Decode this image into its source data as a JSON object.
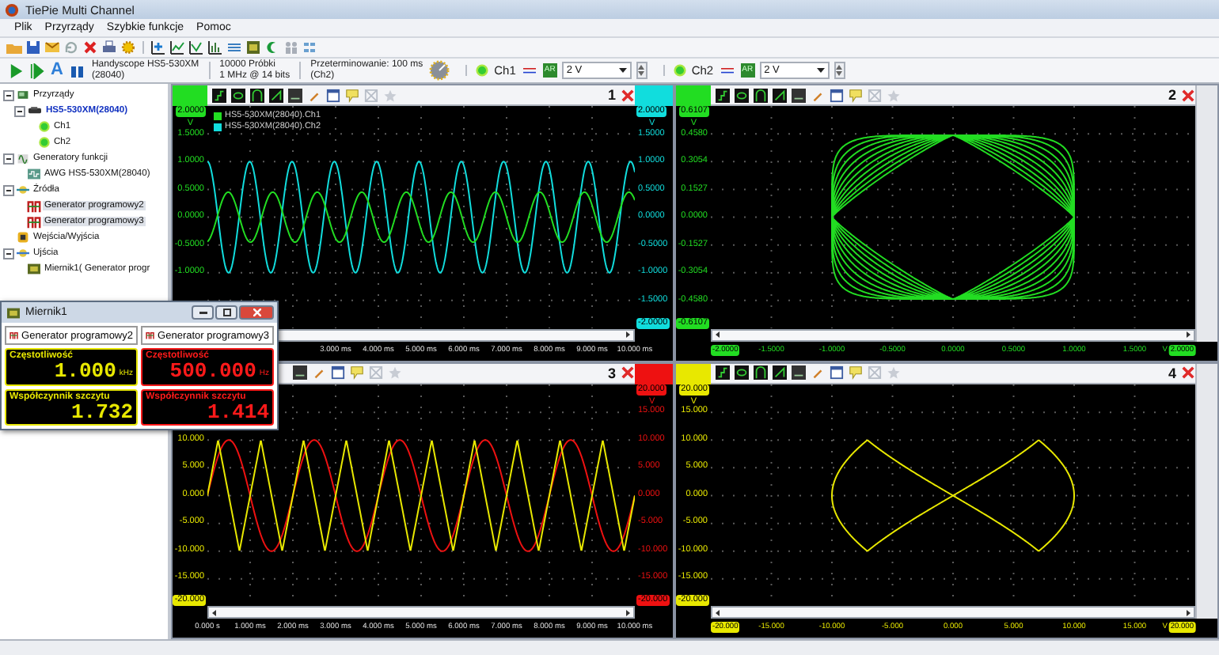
{
  "window": {
    "title": "TiePie Multi Channel"
  },
  "menu": [
    {
      "label": "Plik"
    },
    {
      "label": "Przyrządy"
    },
    {
      "label": "Szybkie funkcje"
    },
    {
      "label": "Pomoc"
    }
  ],
  "instrument_bar": {
    "auto_button": "A",
    "device_name": "Handyscope HS5-530XM",
    "device_serial": "(28040)",
    "record_length": "10000 Próbki",
    "sample_rate": "1 MHz @ 14 bits",
    "trigger": "Przeterminowanie: 100 ms",
    "trigger_source": "(Ch2)",
    "channels": [
      {
        "label": "Ch1",
        "autorange": "AR",
        "range": "2 V"
      },
      {
        "label": "Ch2",
        "autorange": "AR",
        "range": "2 V"
      }
    ]
  },
  "tree": [
    {
      "label": "Przyrządy",
      "kind": "instruments",
      "selected": false,
      "expanded": true,
      "children": [
        {
          "label": "HS5-530XM(28040)",
          "kind": "device",
          "selected": false,
          "expanded": true,
          "children": [
            {
              "label": "Ch1",
              "kind": "channel",
              "selected": false
            },
            {
              "label": "Ch2",
              "kind": "channel",
              "selected": false
            }
          ]
        }
      ]
    },
    {
      "label": "Generatory funkcji",
      "kind": "generators",
      "selected": false,
      "expanded": true,
      "children": [
        {
          "label": "AWG HS5-530XM(28040)",
          "kind": "awg",
          "selected": false
        }
      ]
    },
    {
      "label": "Źródła",
      "kind": "sources",
      "selected": false,
      "expanded": true,
      "children": [
        {
          "label": "Generator programowy2",
          "kind": "generator",
          "selected": true
        },
        {
          "label": "Generator programowy3",
          "kind": "generator",
          "selected": true
        }
      ]
    },
    {
      "label": "Wejścia/Wyjścia",
      "kind": "io",
      "selected": false
    },
    {
      "label": "Ujścia",
      "kind": "sinks",
      "selected": false,
      "expanded": true,
      "children": [
        {
          "label": "Miernik1( Generator progr",
          "kind": "meter",
          "selected": false
        }
      ]
    }
  ],
  "scopes": [
    {
      "number": "1",
      "kind": "yt",
      "legend": [
        {
          "label": "HS5-530XM(28040).Ch1",
          "color": "#22dd22"
        },
        {
          "label": "HS5-530XM(28040).Ch2",
          "color": "#11dddd"
        }
      ],
      "left_axis": {
        "color": "#22dd22",
        "top_label": "2.0000",
        "unit": "V",
        "ticks": [
          "1.5000",
          "1.0000",
          "0.5000",
          "0.0000",
          "-0.5000",
          "-1.0000"
        ]
      },
      "right_axis": {
        "color": "#11dddd",
        "top_label": "2.0000",
        "unit": "V",
        "ticks": [
          "1.5000",
          "1.0000",
          "0.5000",
          "0.0000",
          "-0.5000",
          "-1.0000",
          "-1.5000"
        ],
        "bottom_label": "-2.0000"
      },
      "x_axis": {
        "ticks": [
          "3.000 ms",
          "4.000 ms",
          "5.000 ms",
          "6.000 ms",
          "7.000 ms",
          "8.000 ms",
          "9.000 ms",
          "10.000 ms"
        ]
      }
    },
    {
      "number": "2",
      "kind": "xy",
      "left_axis": {
        "color": "#22dd22",
        "top_label": "0.6107",
        "unit": "V",
        "ticks": [
          "0.4580",
          "0.3054",
          "0.1527",
          "0.0000",
          "-0.1527",
          "-0.3054",
          "-0.4580"
        ],
        "bottom_label": "-0.6107"
      },
      "x_axis": {
        "color": "#22dd22",
        "left_label": "-2.0000",
        "ticks": [
          "-1.5000",
          "-1.0000",
          "-0.5000",
          "0.0000",
          "0.5000",
          "1.0000",
          "1.5000"
        ],
        "unit": "V",
        "right_label": "2.0000"
      }
    },
    {
      "number": "3",
      "kind": "yt",
      "left_axis": {
        "color": "#e8e800",
        "ticks": [
          "10.000",
          "5.000",
          "0.000",
          "-5.000",
          "-10.000",
          "-15.000"
        ],
        "bottom_label": "-20.000"
      },
      "right_axis": {
        "color": "#ee1111",
        "top_label": "20.000",
        "unit": "V",
        "ticks": [
          "15.000",
          "10.000",
          "5.000",
          "0.000",
          "-5.000",
          "-10.000",
          "-15.000"
        ],
        "bottom_label": "-20.000"
      },
      "x_axis": {
        "ticks": [
          "0.000 s",
          "1.000 ms",
          "2.000 ms",
          "3.000 ms",
          "4.000 ms",
          "5.000 ms",
          "6.000 ms",
          "7.000 ms",
          "8.000 ms",
          "9.000 ms",
          "10.000 ms"
        ]
      }
    },
    {
      "number": "4",
      "kind": "xy",
      "left_axis": {
        "color": "#e8e800",
        "top_label": "20.000",
        "unit": "V",
        "ticks": [
          "15.000",
          "10.000",
          "5.000",
          "0.000",
          "-5.000",
          "-10.000",
          "-15.000"
        ],
        "bottom_label": "-20.000"
      },
      "x_axis": {
        "color": "#e8e800",
        "left_label": "-20.000",
        "ticks": [
          "-15.000",
          "-10.000",
          "-5.000",
          "0.000",
          "5.000",
          "10.000",
          "15.000"
        ],
        "unit": "V",
        "right_label": "20.000"
      }
    }
  ],
  "meter": {
    "title": "Miernik1",
    "columns": [
      {
        "source": "Generator programowy2",
        "color": "#e8e800",
        "readings": [
          {
            "label": "Częstotliwość",
            "value": "1.000",
            "unit": "kHz"
          },
          {
            "label": "Współczynnik szczytu",
            "value": "1.732"
          }
        ]
      },
      {
        "source": "Generator programowy3",
        "color": "#ff1a1a",
        "readings": [
          {
            "label": "Częstotliwość",
            "value": "500.000",
            "unit": "Hz"
          },
          {
            "label": "Współczynnik szczytu",
            "value": "1.414"
          }
        ]
      }
    ]
  }
}
